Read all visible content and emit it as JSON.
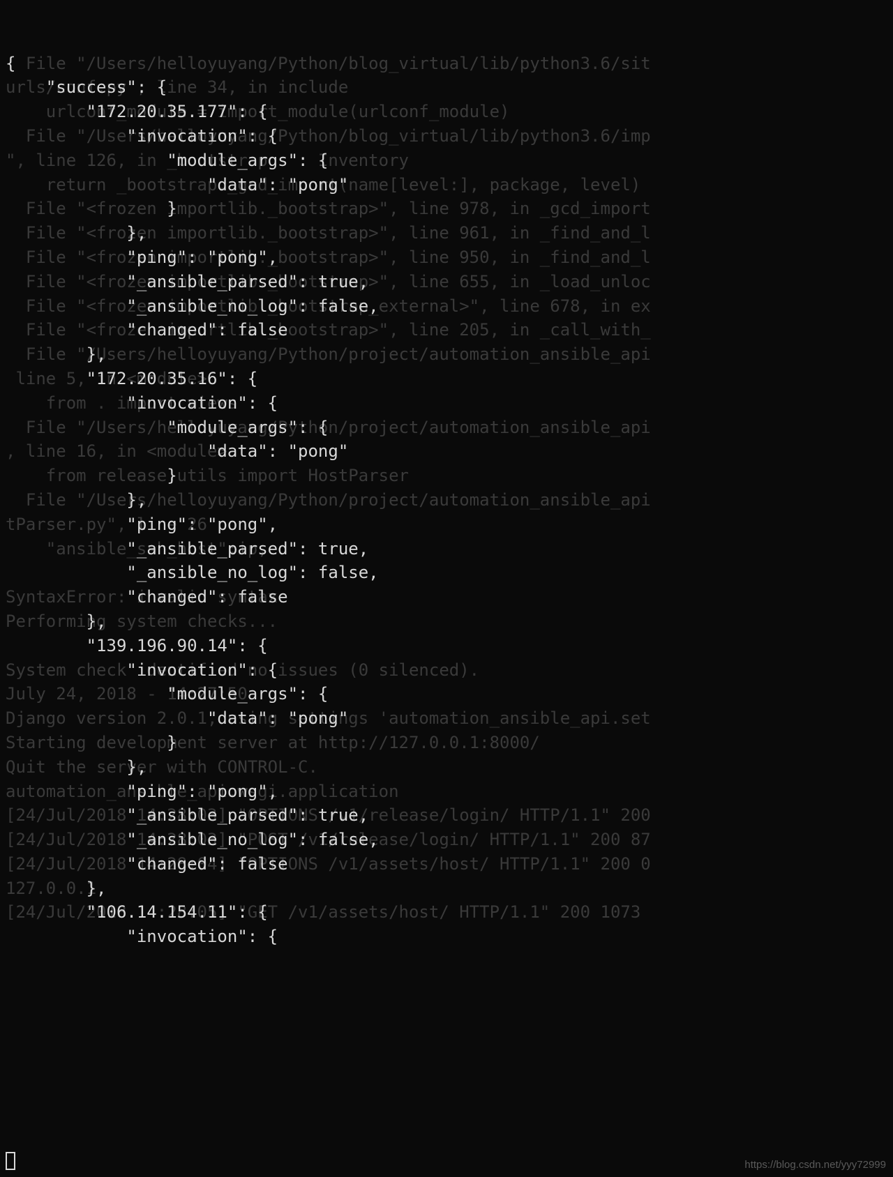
{
  "background_lines": [
    "  File \"/Users/helloyuyang/Python/blog_virtual/lib/python3.6/sit",
    "urls/conf.py\", line 34, in include",
    "    urlconf_module = import_module(urlconf_module)",
    "  File \"/Users/helloyuyang/Python/blog_virtual/lib/python3.6/imp",
    "\", line 126, in _bootstrap     Inventory",
    "    return _bootstrap._gcd_import(name[level:], package, level)",
    "  File \"<frozen importlib._bootstrap>\", line 978, in _gcd_import",
    "  File \"<frozen importlib._bootstrap>\", line 961, in _find_and_l",
    "  File \"<frozen importlib._bootstrap>\", line 950, in _find_and_l",
    "  File \"<frozen importlib._bootstrap>\", line 655, in _load_unloc",
    "  File \"<frozen importlib._bootstrap_external>\", line 678, in ex",
    "  File \"<frozen importlib._bootstrap>\", line 205, in _call_with_",
    "  File \"/Users/helloyuyang/Python/project/automation_ansible_api",
    " line 5, in <module>",
    "    from . import views",
    "  File \"/Users/helloyuyang/Python/project/automation_ansible_api",
    ", line 16, in <module>",
    "    from release.utils import HostParser",
    "  File \"/Users/helloyuyang/Python/project/automation_ansible_api",
    "tParser.py\", line 26",
    "    \"ansible_ssh_host\":ip,",
    "",
    "SyntaxError: invalid syntax",
    "Performing system checks...",
    "",
    "System check identified no issues (0 silenced).",
    "July 24, 2018 - 14:27:50",
    "Django version 2.0.1, using settings 'automation_ansible_api.set",
    "Starting development server at http://127.0.0.1:8000/",
    "Quit the server with CONTROL-C.",
    "automation_ansible_api.wsgi.application",
    "[24/Jul/2018 14:28:03] \"OPTIONS /v1/release/login/ HTTP/1.1\" 200",
    "[24/Jul/2018 14:28:03] \"POST /v1/release/login/ HTTP/1.1\" 200 87",
    "[24/Jul/2018 14:28:04] \"OPTIONS /v1/assets/host/ HTTP/1.1\" 200 0",
    "127.0.0.1",
    "[24/Jul/2018 14:28:05] \"GET /v1/assets/host/ HTTP/1.1\" 200 1073"
  ],
  "foreground_lines": [
    "{",
    "    \"success\": {",
    "        \"172.20.35.177\": {",
    "            \"invocation\": {",
    "                \"module_args\": {",
    "                    \"data\": \"pong\"",
    "                }",
    "            },",
    "            \"ping\": \"pong\",",
    "            \"_ansible_parsed\": true,",
    "            \"_ansible_no_log\": false,",
    "            \"changed\": false",
    "        },",
    "        \"172.20.35.16\": {",
    "            \"invocation\": {",
    "                \"module_args\": {",
    "                    \"data\": \"pong\"",
    "                }",
    "            },",
    "            \"ping\": \"pong\",",
    "            \"_ansible_parsed\": true,",
    "            \"_ansible_no_log\": false,",
    "            \"changed\": false",
    "        },",
    "        \"139.196.90.14\": {",
    "            \"invocation\": {",
    "                \"module_args\": {",
    "                    \"data\": \"pong\"",
    "                }",
    "            },",
    "            \"ping\": \"pong\",",
    "            \"_ansible_parsed\": true,",
    "            \"_ansible_no_log\": false,",
    "            \"changed\": false",
    "        },",
    "        \"106.14.154.11\": {",
    "            \"invocation\": {"
  ],
  "watermark": "https://blog.csdn.net/yyy72999"
}
